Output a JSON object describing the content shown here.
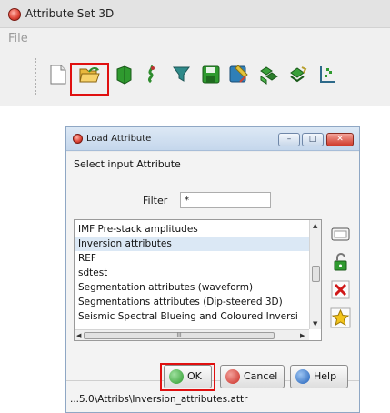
{
  "main_window": {
    "title": "Attribute Set 3D",
    "menu": [
      "File"
    ]
  },
  "toolbar": {
    "icons": [
      "new-set-icon",
      "open-set-icon",
      "default-set-icon",
      "import-attributes-icon",
      "import-from-file-icon",
      "save-set-icon",
      "save-as-icon",
      "evaluate-attribute-icon",
      "evaluate-set-icon",
      "crossplot-icon"
    ],
    "highlighted": "open-set-icon"
  },
  "dialog": {
    "title": "Load Attribute",
    "heading": "Select input Attribute",
    "filter_label": "Filter",
    "filter_value": "*",
    "items": [
      "IMF Pre-stack amplitudes",
      "Inversion attributes",
      "REF",
      "sdtest",
      "Segmentation attributes (waveform)",
      "Segmentations attributes (Dip-steered 3D)",
      "Seismic Spectral Blueing and Coloured Inversi"
    ],
    "selected_index": 1,
    "hscroll_grip": "III",
    "buttons": {
      "ok": "OK",
      "cancel": "Cancel",
      "help": "Help"
    },
    "path": "...5.0\\Attribs\\Inversion_attributes.attr"
  },
  "colors": {
    "highlight": "#e01010",
    "selection": "#dbe8f5"
  }
}
